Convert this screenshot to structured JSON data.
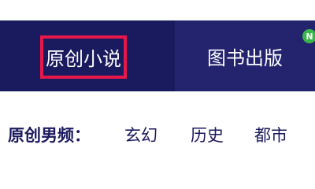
{
  "nav": {
    "tabs": [
      {
        "label": "原创小说"
      },
      {
        "label": "图书出版"
      }
    ],
    "badge": "N"
  },
  "categories": {
    "label": "原创男频：",
    "items": [
      "玄幻",
      "历史",
      "都市"
    ]
  },
  "colors": {
    "nav_bg": "#1a1a5e",
    "highlight_border": "#e8174a",
    "badge": "#39b54a"
  }
}
